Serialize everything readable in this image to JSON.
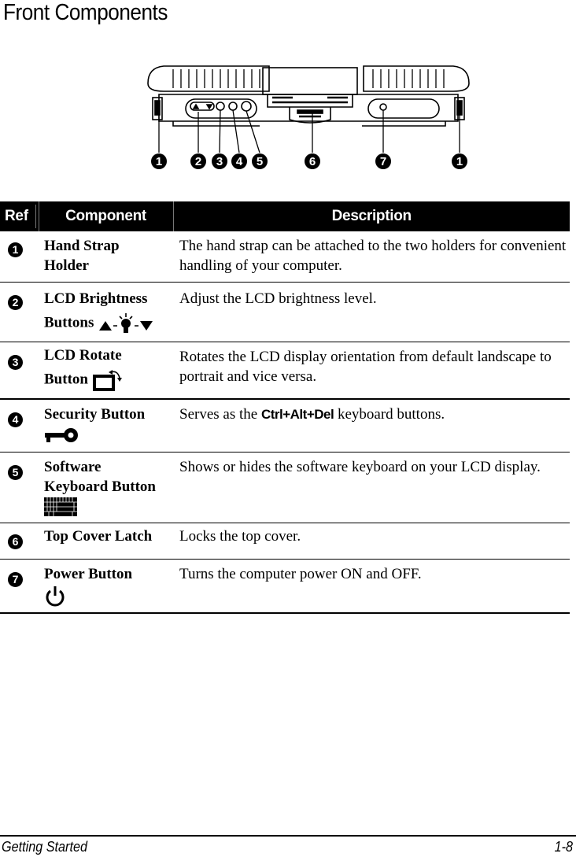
{
  "page": {
    "title": "Front Components"
  },
  "figure": {
    "callouts": [
      "1",
      "2",
      "3",
      "4",
      "5",
      "6",
      "7",
      "1"
    ]
  },
  "table": {
    "headers": {
      "ref": "Ref",
      "component": "Component",
      "description": "Description"
    },
    "rows": [
      {
        "ref": "1",
        "component_line1": "Hand Strap",
        "component_line2": "Holder",
        "icon": "",
        "description": "The hand strap can be attached to the two holders for convenient handling of your computer."
      },
      {
        "ref": "2",
        "component_line1": "LCD Brightness",
        "component_line2": "Buttons",
        "icon": "brightness-up-down-icon",
        "description": "Adjust the LCD brightness level."
      },
      {
        "ref": "3",
        "component_line1": "LCD Rotate",
        "component_line2": "Button",
        "icon": "rotate-display-icon",
        "description": "Rotates the LCD display orientation from default landscape to portrait and vice versa."
      },
      {
        "ref": "4",
        "component_line1": "Security Button",
        "component_line2": "",
        "icon": "key-icon",
        "description_before": "Serves as the ",
        "description_keys": "Ctrl+Alt+Del",
        "description_after": " keyboard buttons."
      },
      {
        "ref": "5",
        "component_line1": "Software",
        "component_line2": "Keyboard Button",
        "icon": "keyboard-icon",
        "description": "Shows or hides the software keyboard on your LCD display."
      },
      {
        "ref": "6",
        "component_line1": "Top Cover Latch",
        "component_line2": "",
        "icon": "",
        "description": "Locks the top cover."
      },
      {
        "ref": "7",
        "component_line1": "Power Button",
        "component_line2": "",
        "icon": "power-icon",
        "description": "Turns the computer power ON and OFF."
      }
    ]
  },
  "footer": {
    "section": "Getting Started",
    "page_number": "1-8"
  }
}
